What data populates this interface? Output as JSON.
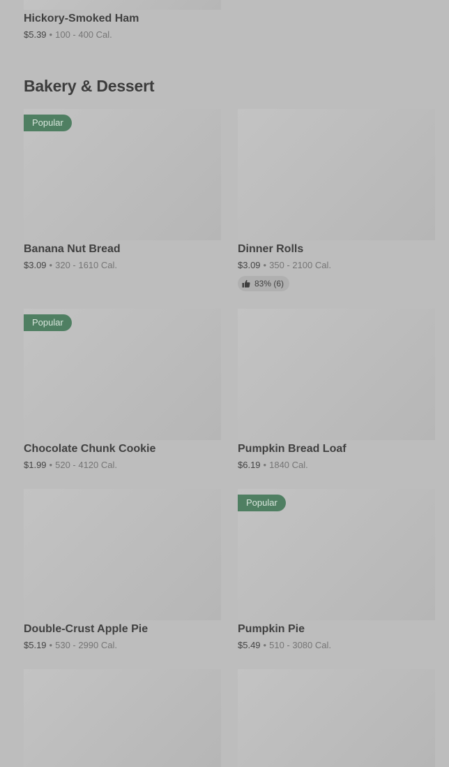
{
  "previous_item": {
    "name": "Hickory-Smoked Ham",
    "price": "$5.39",
    "calories": "100 - 400 Cal."
  },
  "section": {
    "title": "Bakery & Dessert"
  },
  "badge_text": "Popular",
  "separator": "•",
  "items": [
    {
      "name": "Banana Nut Bread",
      "price": "$3.09",
      "calories": "320 - 1610 Cal.",
      "popular": true
    },
    {
      "name": "Dinner Rolls",
      "price": "$3.09",
      "calories": "350 - 2100 Cal.",
      "popular": false,
      "rating": "83% (6)"
    },
    {
      "name": "Chocolate Chunk Cookie",
      "price": "$1.99",
      "calories": "520 - 4120 Cal.",
      "popular": true
    },
    {
      "name": "Pumpkin Bread Loaf",
      "price": "$6.19",
      "calories": "1840 Cal.",
      "popular": false
    },
    {
      "name": "Double-Crust Apple Pie",
      "price": "$5.19",
      "calories": "530 - 2990 Cal.",
      "popular": false
    },
    {
      "name": "Pumpkin Pie",
      "price": "$5.49",
      "calories": "510 - 3080 Cal.",
      "popular": true
    }
  ],
  "icons": {
    "rating": "thumbs-up-icon"
  }
}
